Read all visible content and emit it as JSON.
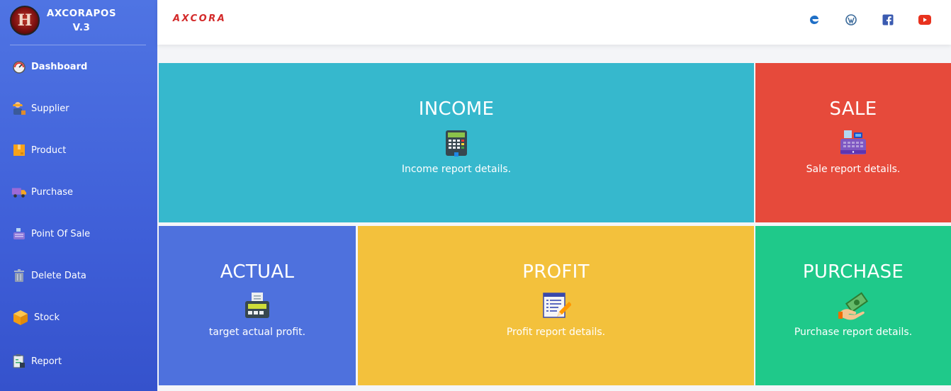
{
  "app": {
    "name": "AXCORAPOS",
    "version": "V.3"
  },
  "header": {
    "brand": "AXCORA",
    "social_icons": [
      "edge-icon",
      "wordpress-icon",
      "facebook-icon",
      "youtube-icon"
    ]
  },
  "sidebar": {
    "items": [
      {
        "label": "Dashboard",
        "icon": "speedometer-icon",
        "active": true
      },
      {
        "label": "Supplier",
        "icon": "supplier-icon"
      },
      {
        "label": "Product",
        "icon": "box-icon"
      },
      {
        "label": "Purchase",
        "icon": "truck-icon"
      },
      {
        "label": "Point Of Sale",
        "icon": "cash-register-icon"
      },
      {
        "label": "Delete Data",
        "icon": "trash-icon"
      },
      {
        "label": "Stock",
        "icon": "stock-box-icon"
      },
      {
        "label": "Report",
        "icon": "report-icon"
      }
    ]
  },
  "tiles": {
    "income": {
      "title": "INCOME",
      "desc": "Income report details.",
      "color": "#36b8cd",
      "icon": "payment-terminal-icon"
    },
    "sale": {
      "title": "SALE",
      "desc": "Sale report details.",
      "color": "#e64a3b",
      "icon": "cash-register-icon"
    },
    "actual": {
      "title": "ACTUAL",
      "desc": "target actual profit.",
      "color": "#4e71dd",
      "icon": "receipt-printer-icon"
    },
    "profit": {
      "title": "PROFIT",
      "desc": "Profit report details.",
      "color": "#f3c13c",
      "icon": "document-edit-icon"
    },
    "purchase": {
      "title": "PURCHASE",
      "desc": "Purchase report details.",
      "color": "#1fc98a",
      "icon": "money-hand-icon"
    }
  }
}
